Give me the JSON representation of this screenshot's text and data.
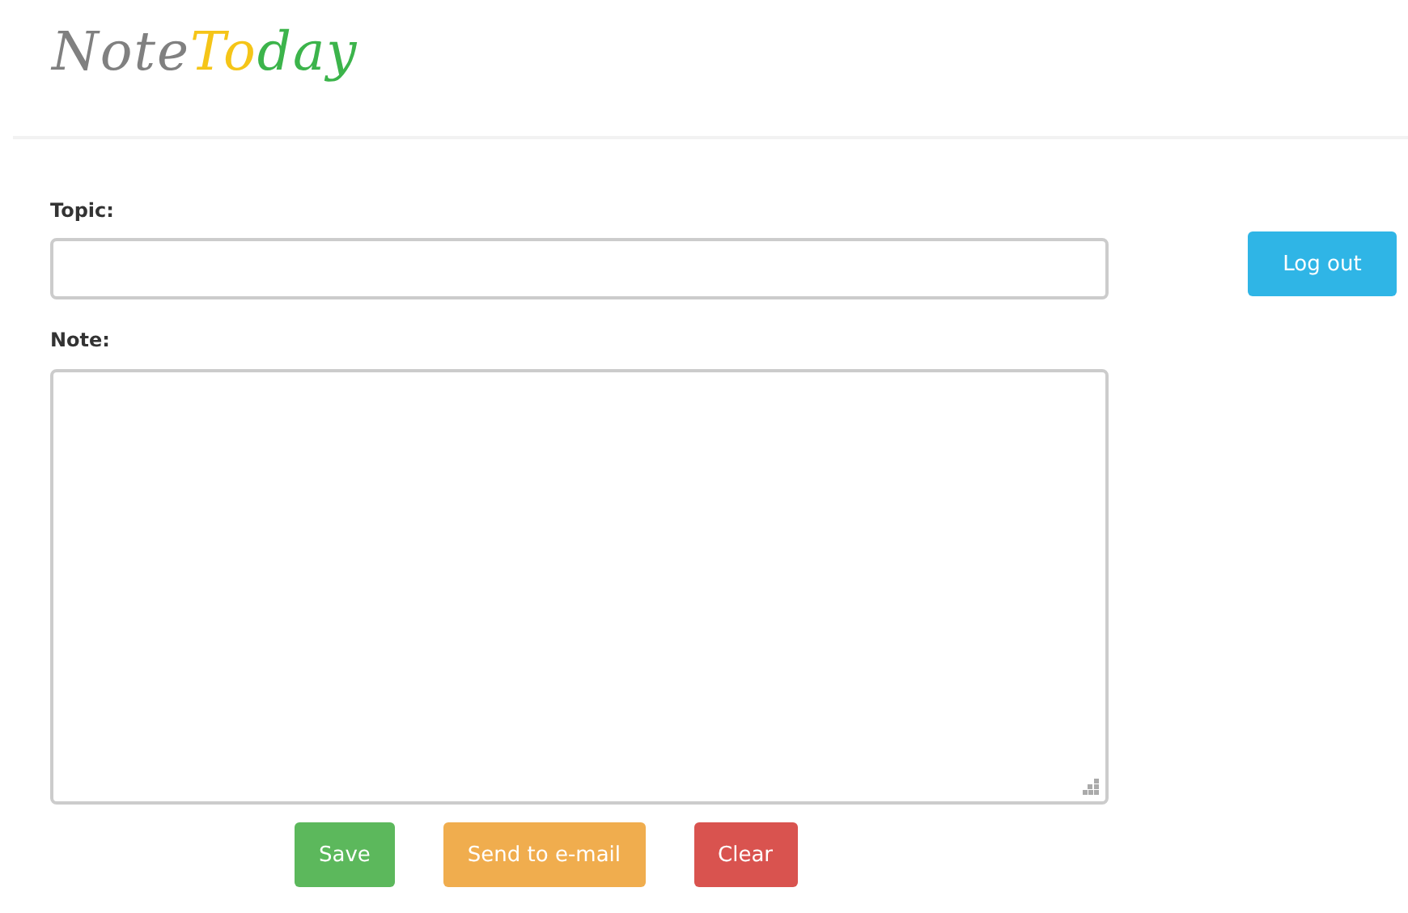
{
  "logo": [
    {
      "text": "Note",
      "color": "#808080"
    },
    {
      "text": "To",
      "color": "#f5c518"
    },
    {
      "text": "day",
      "color": "#3cb44b"
    }
  ],
  "topic": {
    "label": "Topic:"
  },
  "logout_button": "Log out",
  "note": {
    "label": "Note:"
  },
  "buttons": [
    {
      "label": "Save",
      "kind": "success"
    },
    {
      "label": "Send to e-mail",
      "kind": "warning"
    },
    {
      "label": "Clear",
      "kind": "danger"
    }
  ]
}
